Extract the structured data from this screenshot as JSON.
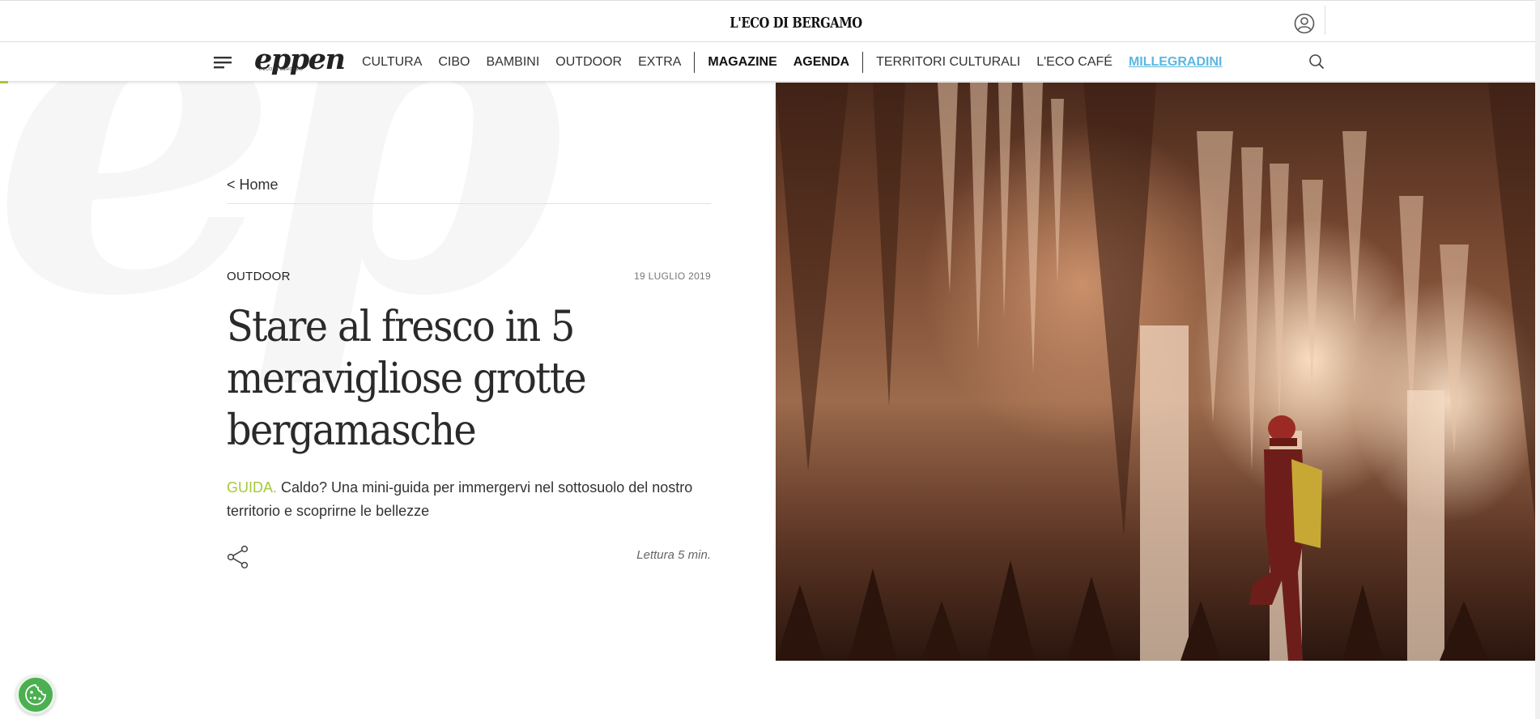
{
  "header": {
    "brand": "L'ECO DI BERGAMO",
    "icons": {
      "user": "user-icon"
    }
  },
  "nav": {
    "logo": "eppen",
    "logo_sub": "L'ECO DI BERGAMO",
    "items": [
      {
        "label": "CULTURA",
        "style": "normal"
      },
      {
        "label": "CIBO",
        "style": "normal"
      },
      {
        "label": "BAMBINI",
        "style": "normal"
      },
      {
        "label": "OUTDOOR",
        "style": "normal"
      },
      {
        "label": "EXTRA",
        "style": "normal"
      },
      {
        "label": "MAGAZINE",
        "style": "bold"
      },
      {
        "label": "AGENDA",
        "style": "bold"
      },
      {
        "label": "TERRITORI CULTURALI",
        "style": "normal"
      },
      {
        "label": "L'ECO CAFÉ",
        "style": "normal"
      },
      {
        "label": "MILLEGRADINI",
        "style": "accent"
      }
    ],
    "icons": {
      "menu": "hamburger-menu-icon",
      "search": "search-icon"
    }
  },
  "article": {
    "breadcrumb": "< Home",
    "category": "OUTDOOR",
    "date": "19 LUGLIO 2019",
    "title": "Stare al fresco in 5 meravigliose grotte bergamasche",
    "summary_tag": "GUIDA.",
    "summary": " Caldo? Una mini-guida per immergervi nel sottosuolo del nostro territorio e scoprirne le bellezze",
    "reading_time": "Lettura 5 min.",
    "icons": {
      "share": "share-icon"
    }
  },
  "watermark": "ep",
  "colors": {
    "accent_green": "#a5c83b",
    "accent_blue": "#5bb8e0",
    "cookie": "#4caf50"
  },
  "cookie": {
    "icon": "cookie-settings-icon"
  }
}
